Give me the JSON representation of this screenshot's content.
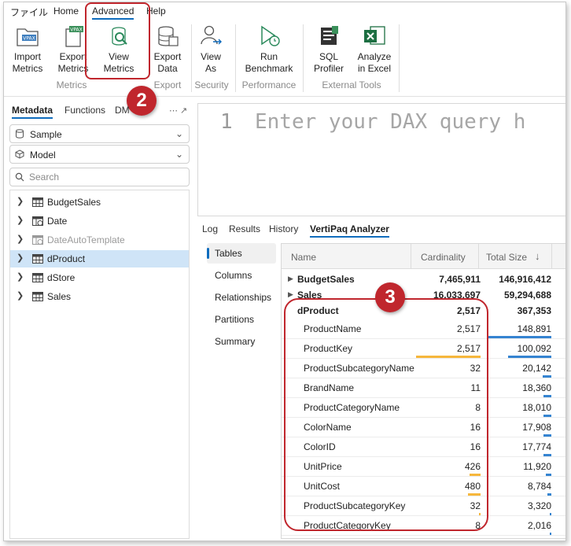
{
  "menu": {
    "tabs": [
      "ファイル",
      "Home",
      "Advanced",
      "Help"
    ]
  },
  "ribbon": {
    "buttons": {
      "import_metrics": "Import\nMetrics",
      "export_metrics": "Export\nMetrics",
      "view_metrics": "View\nMetrics",
      "export_data": "Export\nData",
      "view_as": "View\nAs",
      "run_benchmark": "Run\nBenchmark",
      "sql_profiler": "SQL\nProfiler",
      "analyze_in_excel": "Analyze\nin Excel"
    },
    "groups": {
      "metrics": "Metrics",
      "export": "Export",
      "security": "Security",
      "performance": "Performance",
      "external_tools": "External Tools"
    },
    "icon_text": {
      "vpax": "VPAX"
    }
  },
  "callouts": {
    "ribbon": "2",
    "columns": "3"
  },
  "left_panel": {
    "tabs": [
      "Metadata",
      "Functions",
      "DM"
    ],
    "pin_icons": "⋯ ↗",
    "database": "Sample",
    "model": "Model",
    "search_placeholder": "Search",
    "tree": [
      {
        "label": "BudgetSales",
        "dim": false
      },
      {
        "label": "Date",
        "dim": false
      },
      {
        "label": "DateAutoTemplate",
        "dim": true
      },
      {
        "label": "dProduct",
        "dim": false,
        "selected": true
      },
      {
        "label": "dStore",
        "dim": false
      },
      {
        "label": "Sales",
        "dim": false
      }
    ]
  },
  "editor": {
    "line_number": "1",
    "placeholder": "Enter your DAX query h"
  },
  "bottom_tabs": [
    "Log",
    "Results",
    "History",
    "VertiPaq Analyzer"
  ],
  "vertipaq_nav": [
    "Tables",
    "Columns",
    "Relationships",
    "Partitions",
    "Summary"
  ],
  "grid": {
    "headers": {
      "name": "Name",
      "cardinality": "Cardinality",
      "total_size": "Total Size"
    },
    "tables": [
      {
        "name": "BudgetSales",
        "cardinality": "7,465,911",
        "total_size": "146,916,412"
      },
      {
        "name": "Sales",
        "cardinality": "16,033,697",
        "total_size": "59,294,688"
      },
      {
        "name": "dProduct",
        "cardinality": "2,517",
        "total_size": "367,353"
      }
    ],
    "columns": [
      {
        "name": "ProductName",
        "cardinality": "2,517",
        "total_size": "148,891",
        "card_bar": 0,
        "size_bar": 1.0
      },
      {
        "name": "ProductKey",
        "cardinality": "2,517",
        "total_size": "100,092",
        "card_bar": 1.0,
        "size_bar": 0.67
      },
      {
        "name": "ProductSubcategoryName",
        "cardinality": "32",
        "total_size": "20,142",
        "card_bar": 0.0,
        "size_bar": 0.14
      },
      {
        "name": "BrandName",
        "cardinality": "11",
        "total_size": "18,360",
        "card_bar": 0.0,
        "size_bar": 0.12
      },
      {
        "name": "ProductCategoryName",
        "cardinality": "8",
        "total_size": "18,010",
        "card_bar": 0.0,
        "size_bar": 0.12
      },
      {
        "name": "ColorName",
        "cardinality": "16",
        "total_size": "17,908",
        "card_bar": 0.0,
        "size_bar": 0.12
      },
      {
        "name": "ColorID",
        "cardinality": "16",
        "total_size": "17,774",
        "card_bar": 0.0,
        "size_bar": 0.12
      },
      {
        "name": "UnitPrice",
        "cardinality": "426",
        "total_size": "11,920",
        "card_bar": 0.17,
        "size_bar": 0.08
      },
      {
        "name": "UnitCost",
        "cardinality": "480",
        "total_size": "8,784",
        "card_bar": 0.19,
        "size_bar": 0.06
      },
      {
        "name": "ProductSubcategoryKey",
        "cardinality": "32",
        "total_size": "3,320",
        "card_bar": 0.01,
        "size_bar": 0.02
      },
      {
        "name": "ProductCategoryKey",
        "cardinality": "8",
        "total_size": "2,016",
        "card_bar": 0.0,
        "size_bar": 0.01
      }
    ]
  },
  "colors": {
    "accent": "#0f6cbd",
    "callout": "#c0262d",
    "card_bar": "#f6b73c",
    "size_bar": "#3584d1",
    "selected_row": "#cfe4f7"
  }
}
